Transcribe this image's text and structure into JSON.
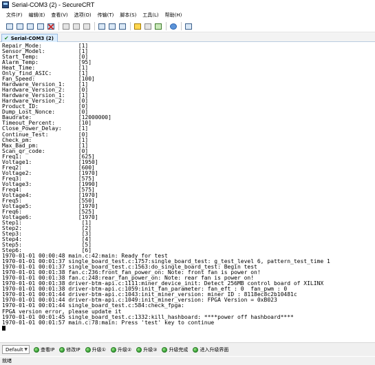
{
  "window": {
    "title": "Serial-COM3 (2) - SecureCRT"
  },
  "menu": [
    "文件(F)",
    "编辑(E)",
    "查看(V)",
    "选项(O)",
    "传输(T)",
    "脚本(S)",
    "工具(L)",
    "帮助(H)"
  ],
  "toolbar": {
    "icons": [
      "connect-icon",
      "quick-connect-icon",
      "connect-tab-icon",
      "reconnect-icon",
      "disconnect-icon",
      "copy-icon",
      "paste-icon",
      "find-icon",
      "print-icon",
      "print-setup-icon",
      "log-icon",
      "session-options-icon",
      "global-options-icon",
      "sftp-icon",
      "keymap-icon",
      "help-icon",
      "screen-icon"
    ]
  },
  "tab": {
    "label": "Serial-COM3 (2)"
  },
  "terminal": {
    "lines": [
      "Repair_Mode:           [1]",
      "Sensor_Model:          [1]",
      "Start_Temp:            [0]",
      "Alarm_Temp:            [95]",
      "Heat_Time:             [1]",
      "Only_find_ASIC:        [1]",
      "Fan_Speed:             [100]",
      "Hardware_Version_1:    [1]",
      "Hardware_Version_2:    [0]",
      "Hardware_Version_1:    [1]",
      "Hardware_Version_2:    [0]",
      "Product_ID:            [0]",
      "Dump_Lost_Nonce:       [0]",
      "Baudrate:              [12000000]",
      "Timeout_Percent:       [10]",
      "Close_Power_Delay:     [1]",
      "Continue_Test:         [0]",
      "Check_pm:              [1]",
      "Max_Bad_pm:            [1]",
      "Scan_qr_code:          [0]",
      "Freq1:                 [625]",
      "Voltage1:              [1950]",
      "Freq2:                 [600]",
      "Voltage2:              [1970]",
      "Freq3:                 [575]",
      "Voltage3:              [1990]",
      "Freq4:                 [575]",
      "Voltage4:              [1970]",
      "Freq5:                 [550]",
      "Voltage5:              [1970]",
      "Freq6:                 [525]",
      "Voltage6:              [1970]",
      "Step1:                  [1]",
      "Step2:                  [2]",
      "Step3:                  [3]",
      "Step4:                  [4]",
      "Step5:                  [5]",
      "Step6:                  [6]",
      "1970-01-01 00:00:48 main.c:42:main: Ready for test",
      "1970-01-01 00:01:37 single_board_test.c:1757:single_board_test: g_test_level 6, pattern_test_time 1",
      "1970-01-01 00:01:37 single_board_test.c:1563:do_single_board_test: Begin test",
      "1970-01-01 00:01:38 fan.c:236:front_fan_power_on: Note: front fan is power on!",
      "1970-01-01 00:01:38 fan.c:248:rear_fan_power_on: Note: rear fan is power on!",
      "1970-01-01 00:01:38 driver-btm-api.c:1111:miner_device_init: Detect 256MB control board of XILINX",
      "1970-01-01 00:01:38 driver-btm-api.c:1059:init_fan_parameter: fan_eft : 0  fan_pwm : 0",
      "1970-01-01 00:01:44 driver-btm-api.c:1043:init_miner_version: miner ID : 8118ec8c2b10481c",
      "1970-01-01 00:01:44 driver-btm-api.c:1049:init_miner_version: FPGA Version = 0xB023",
      "1970-01-01 00:01:44 single_board_test.c:584:check_fpga:",
      "FPGA version error, please update it",
      "1970-01-01 00:01:45 single_board_test.c:1332:kill_hashboard: ****power off hashboard****",
      "1970-01-01 00:01:57 main.c:78:main: Press 'test' key to continue"
    ]
  },
  "buttonbar": {
    "session_select": "Default",
    "buttons": [
      "查看IP",
      "修改IP",
      "升级①",
      "升级②",
      "升级③",
      "升级完成",
      "进入升级界面"
    ]
  },
  "status": {
    "text": "就绪"
  }
}
